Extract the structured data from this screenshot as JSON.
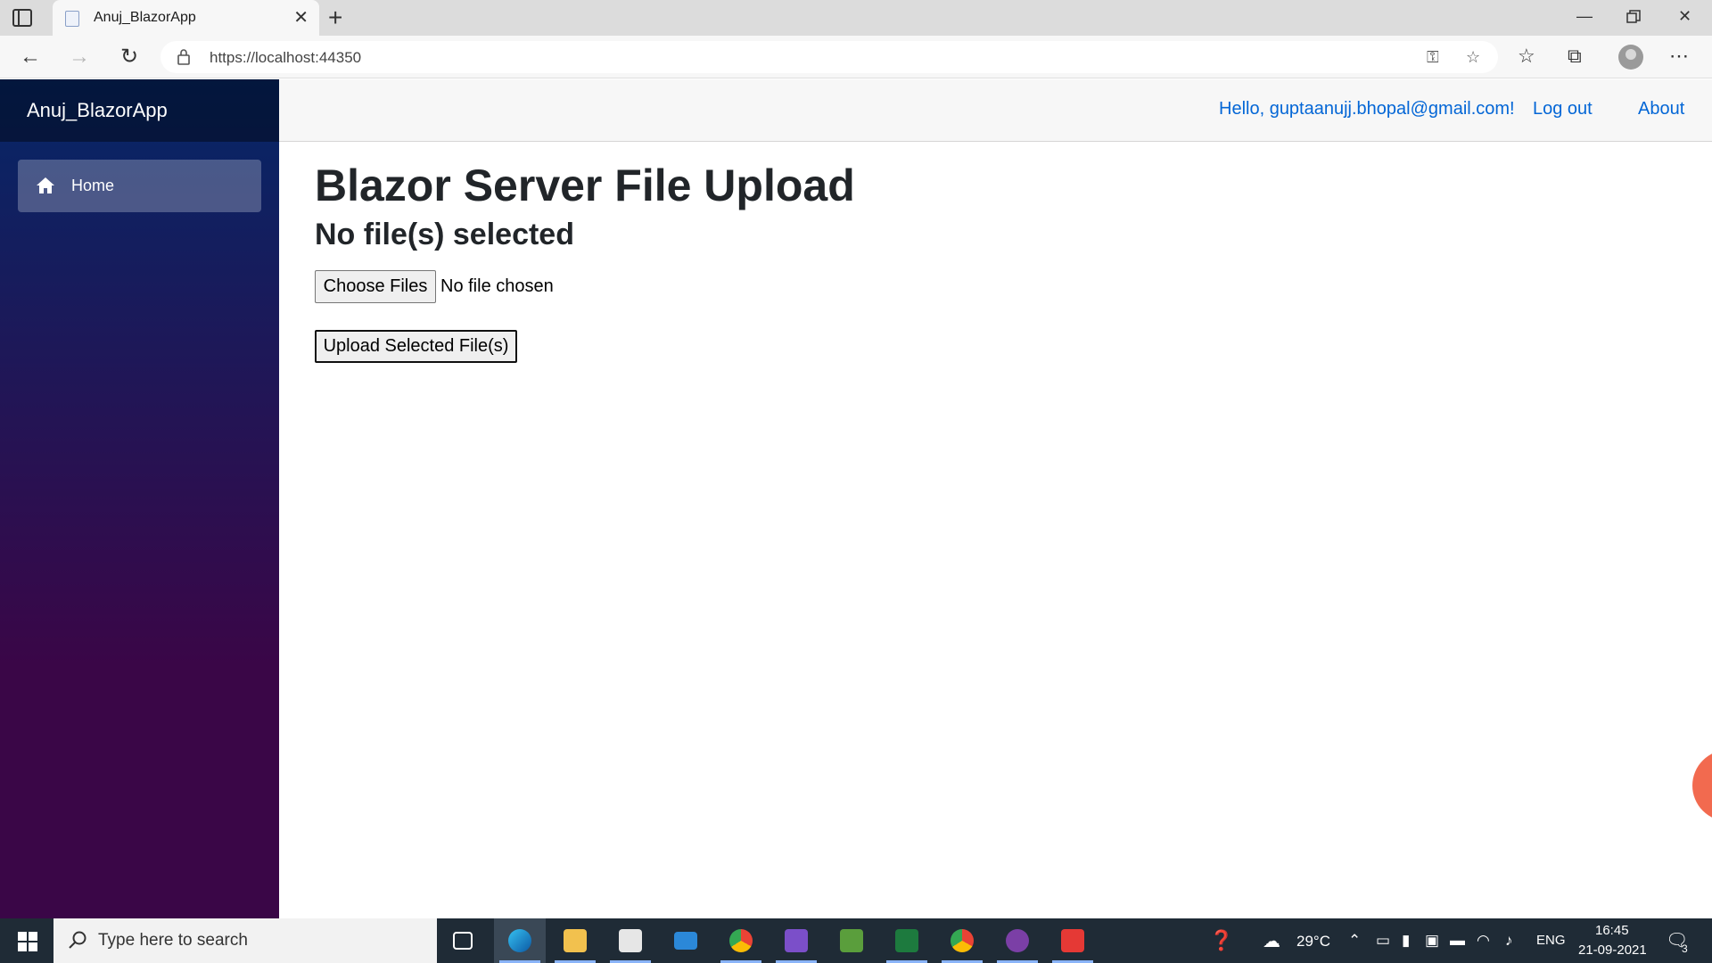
{
  "browser": {
    "tab_title": "Anuj_BlazorApp",
    "url": "https://localhost:44350",
    "win_controls": [
      "minimize",
      "restore",
      "close"
    ]
  },
  "app": {
    "brand": "Anuj_BlazorApp",
    "nav": [
      {
        "label": "Home",
        "icon": "home-icon",
        "active": true
      }
    ],
    "topbar": {
      "greeting": "Hello, guptaanujj.bhopal@gmail.com!",
      "logout": "Log out",
      "about": "About"
    },
    "main": {
      "title": "Blazor Server File Upload",
      "subtitle": "No file(s) selected",
      "choose_files": "Choose Files",
      "file_status": "No file chosen",
      "upload_button": "Upload Selected File(s)"
    }
  },
  "taskbar": {
    "search_placeholder": "Type here to search",
    "apps": [
      "task-view-icon",
      "edge-icon",
      "file-explorer-icon",
      "store-icon",
      "mail-icon",
      "chrome-icon",
      "visual-studio-icon",
      "image-app-icon",
      "excel-icon",
      "chrome-profile-icon",
      "github-desktop-icon",
      "recorder-icon"
    ],
    "weather": "29°C",
    "language": "ENG",
    "time": "16:45",
    "date": "21-09-2021",
    "notifications": "3"
  },
  "colors": {
    "link": "#0366d6",
    "sidebar_top": "#052767",
    "sidebar_bottom": "#3a0647",
    "taskbar": "#1f2b36"
  }
}
